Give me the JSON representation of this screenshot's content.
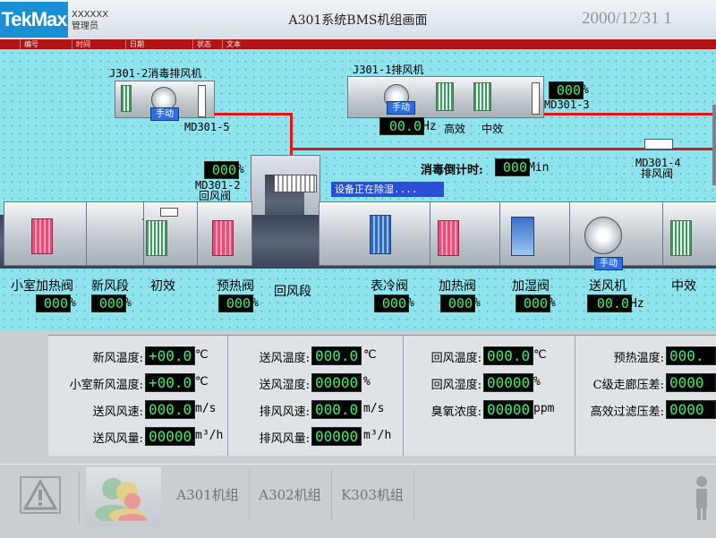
{
  "header": {
    "logo": "TekMax",
    "user_line1": "XXXXXX",
    "user_line2": "管理员",
    "title": "A301系统BMS机组画面",
    "datetime": "2000/12/31 1"
  },
  "alarm_table": {
    "columns": [
      "编号",
      "时间",
      "日期",
      "状态",
      "文本"
    ]
  },
  "process": {
    "exhaust_units": [
      {
        "name": "J301-2消毒排风机",
        "mode": "手动",
        "damper_tag": "MD301-5"
      },
      {
        "name": "J301-1排风机",
        "mode": "手动",
        "frequency": "00.0",
        "freq_unit": "Hz",
        "filter_labels": [
          "高效",
          "中效"
        ],
        "damper_tag": "MD301-3",
        "damper_value": "000",
        "damper_unit": "%"
      }
    ],
    "damper_md301_4": {
      "tag": "MD301-4",
      "name": "排风阀"
    },
    "return_damper": {
      "value": "000",
      "unit": "%",
      "tag": "MD301-2",
      "name": "回风阀"
    },
    "disinfection": {
      "label": "消毒倒计时:",
      "value": "000",
      "unit": "Min"
    },
    "status_message": "设备正在除湿....",
    "supply_fan_mode": "手动",
    "sections": [
      {
        "label": "小室加热阀",
        "value": "000",
        "unit": "%"
      },
      {
        "label": "新风段",
        "value": "000",
        "unit": "%"
      },
      {
        "label": "初效"
      },
      {
        "label": "预热阀",
        "value": "000",
        "unit": "%"
      },
      {
        "label": "回风段"
      },
      {
        "label": "表冷阀",
        "value": "000",
        "unit": "%"
      },
      {
        "label": "加热阀",
        "value": "000",
        "unit": "%"
      },
      {
        "label": "加湿阀",
        "value": "000",
        "unit": "%"
      },
      {
        "label": "送风机",
        "value": "00.0",
        "unit": "Hz"
      },
      {
        "label": "中效"
      }
    ]
  },
  "readouts": {
    "group1": [
      {
        "label": "新风温度:",
        "value": "+00.0",
        "unit": "℃"
      },
      {
        "label": "小室新风温度:",
        "value": "+00.0",
        "unit": "℃"
      },
      {
        "label": "送风风速:",
        "value": "000.0",
        "unit": "m/s"
      },
      {
        "label": "送风风量:",
        "value": "00000",
        "unit": "m³/h"
      }
    ],
    "group2": [
      {
        "label": "送风温度:",
        "value": "000.0",
        "unit": "℃"
      },
      {
        "label": "送风湿度:",
        "value": "00000",
        "unit": "%"
      },
      {
        "label": "排风风速:",
        "value": "000.0",
        "unit": "m/s"
      },
      {
        "label": "排风风量:",
        "value": "00000",
        "unit": "m³/h"
      }
    ],
    "group3": [
      {
        "label": "回风温度:",
        "value": "000.0",
        "unit": "℃"
      },
      {
        "label": "回风湿度:",
        "value": "00000",
        "unit": "%"
      },
      {
        "label": "臭氧浓度:",
        "value": "00000",
        "unit": "ppm"
      }
    ],
    "group4": [
      {
        "label": "预热温度:",
        "value": "000."
      },
      {
        "label": "C级走廊压差:",
        "value": "0000"
      },
      {
        "label": "高效过滤压差:",
        "value": "0000"
      }
    ]
  },
  "footer": {
    "unit_buttons": [
      "A301机组",
      "A302机组",
      "K303机组"
    ]
  },
  "icons": {
    "alarm": "warning-triangle-icon",
    "users": "users-icon",
    "person": "person-icon"
  },
  "colors": {
    "alarm_bar": "#b01414",
    "background": "#8fe3ec",
    "value_text": "#3bf06a",
    "pipe": "#e01515",
    "mode_button": "#2d6fe0"
  }
}
